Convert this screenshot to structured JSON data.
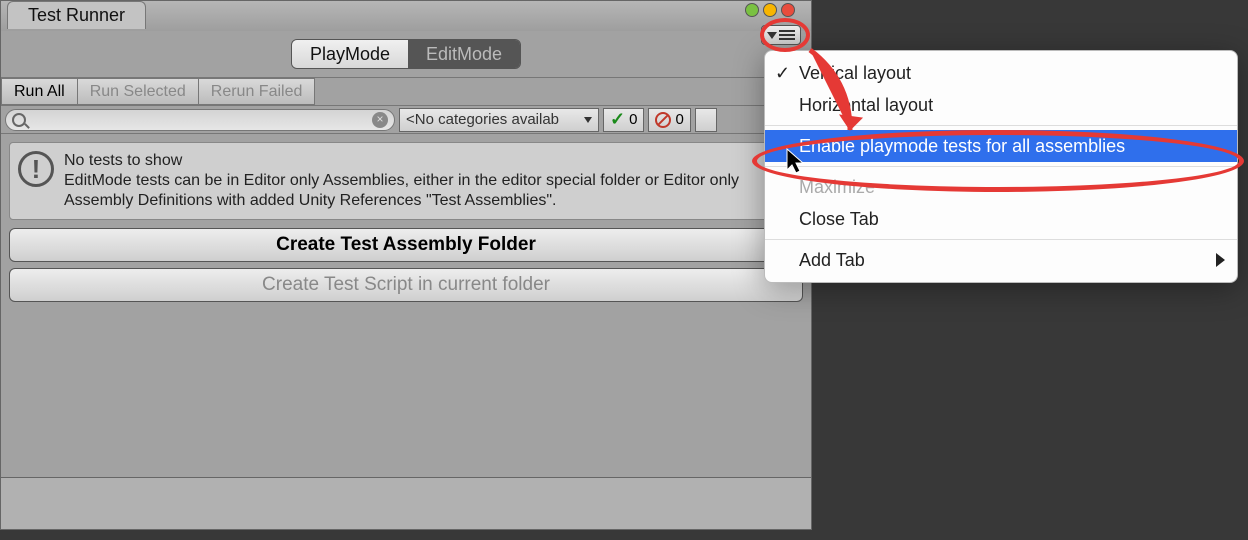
{
  "window": {
    "tab_title": "Test Runner"
  },
  "mode_tabs": {
    "playmode": "PlayMode",
    "editmode": "EditMode",
    "active": "PlayMode"
  },
  "toolbar": {
    "run_all": "Run All",
    "run_selected": "Run Selected",
    "rerun_failed": "Rerun Failed"
  },
  "filter": {
    "search_placeholder": "",
    "category_dropdown": "<No categories availab",
    "pass_count": "0",
    "fail_count": "0"
  },
  "hint": {
    "title": "No tests to show",
    "body": "EditMode tests can be in Editor only Assemblies, either in the editor special folder or Editor only Assembly Definitions with added Unity References \"Test Assemblies\"."
  },
  "buttons": {
    "create_folder": "Create Test Assembly Folder",
    "create_script": "Create Test Script in current folder"
  },
  "context_menu": {
    "items": [
      {
        "label": "Vertical layout",
        "checked": true
      },
      {
        "label": "Horizontal layout"
      },
      {
        "label": "Enable playmode tests for all assemblies",
        "selected": true
      },
      {
        "label": "Maximize",
        "disabled": true
      },
      {
        "label": "Close Tab"
      },
      {
        "label": "Add Tab",
        "submenu": true
      }
    ]
  }
}
